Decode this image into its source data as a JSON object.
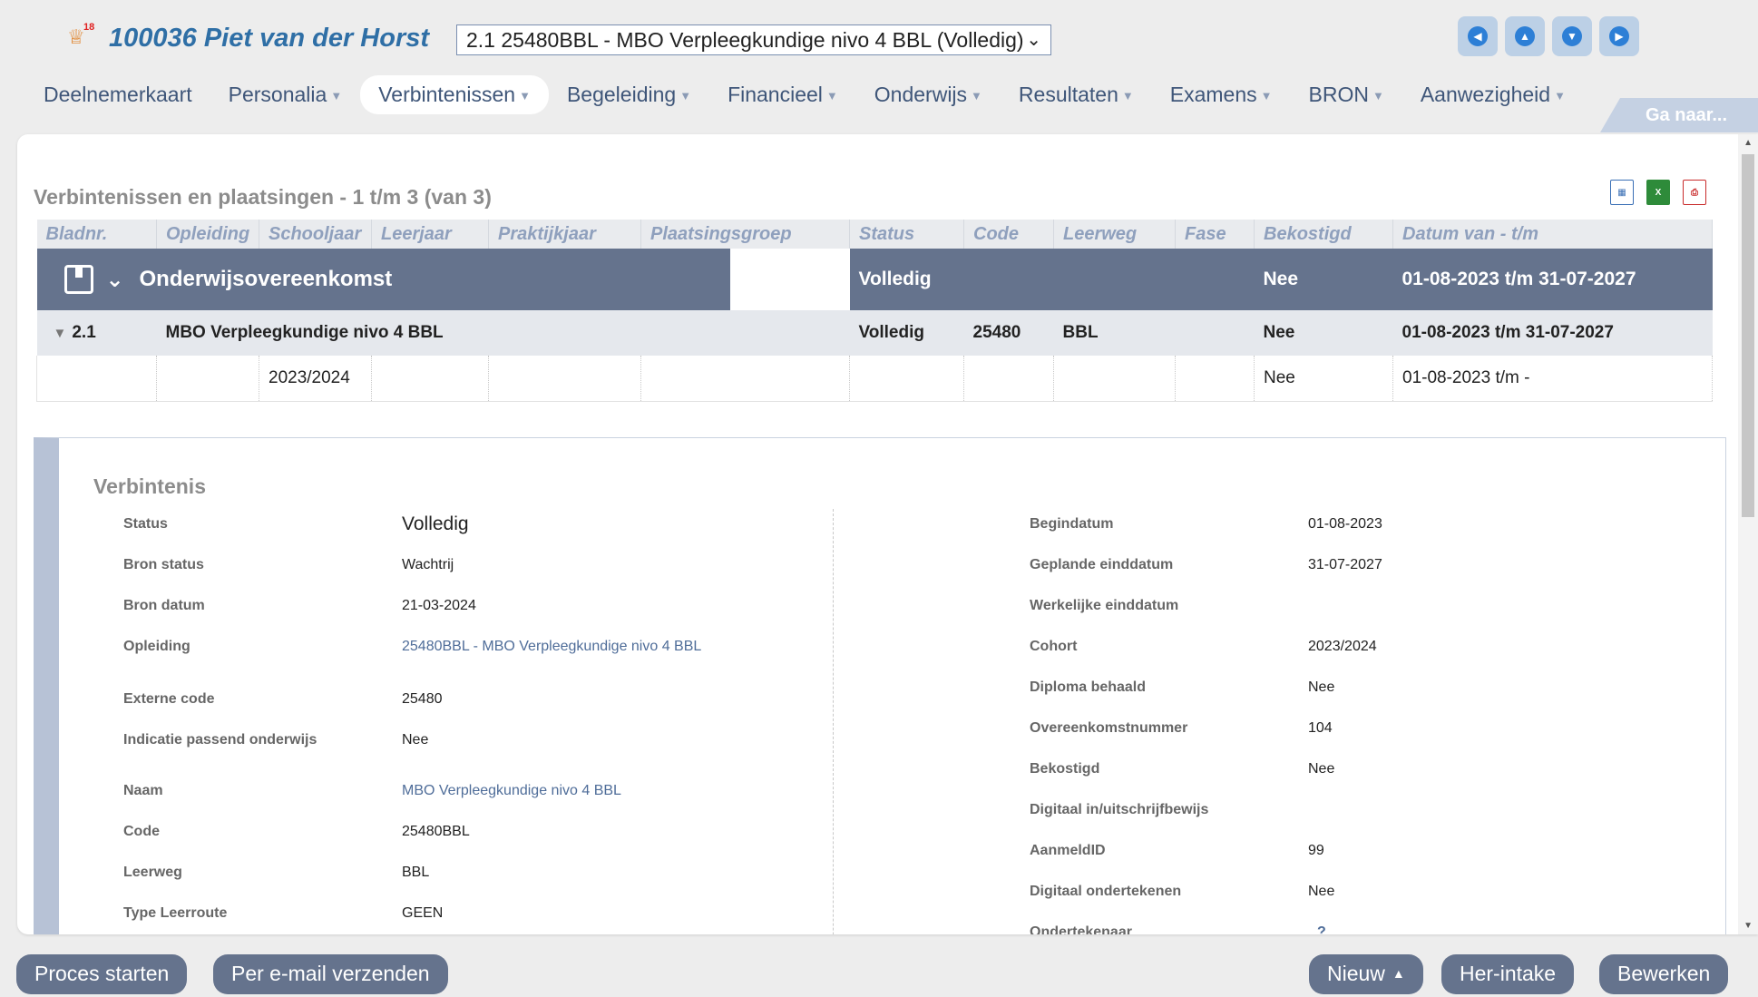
{
  "header": {
    "student_badge": "18",
    "student_title": "100036 Piet van der Horst",
    "program_select": "2.1 25480BBL - MBO Verpleegkundige nivo 4 BBL (Volledig)",
    "nav_icons": [
      "previous-icon",
      "up-icon",
      "down-icon",
      "next-icon"
    ]
  },
  "menu": [
    {
      "label": "Deelnemerkaart",
      "dropdown": false
    },
    {
      "label": "Personalia",
      "dropdown": true
    },
    {
      "label": "Verbintenissen",
      "dropdown": true,
      "active": true
    },
    {
      "label": "Begeleiding",
      "dropdown": true
    },
    {
      "label": "Financieel",
      "dropdown": true
    },
    {
      "label": "Onderwijs",
      "dropdown": true
    },
    {
      "label": "Resultaten",
      "dropdown": true
    },
    {
      "label": "Examens",
      "dropdown": true
    },
    {
      "label": "BRON",
      "dropdown": true
    },
    {
      "label": "Aanwezigheid",
      "dropdown": true
    }
  ],
  "goto_label": "Ga naar...",
  "list": {
    "title": "Verbintenissen en plaatsingen - 1 t/m 3 (van 3)",
    "columns": [
      "Bladnr.",
      "Opleiding",
      "Schooljaar",
      "Leerjaar",
      "Praktijkjaar",
      "Plaatsingsgroep",
      "Status",
      "Code",
      "Leerweg",
      "Fase",
      "Bekostigd",
      "Datum van - t/m"
    ],
    "group": {
      "name": "Onderwijsovereenkomst",
      "status": "Volledig",
      "bekostigd": "Nee",
      "datum": "01-08-2023 t/m 31-07-2027"
    },
    "row1": {
      "bladnr": "2.1",
      "opleiding": "MBO Verpleegkundige nivo 4 BBL",
      "status": "Volledig",
      "code": "25480",
      "leerweg": "BBL",
      "bekostigd": "Nee",
      "datum": "01-08-2023 t/m 31-07-2027"
    },
    "row2": {
      "schooljaar": "2023/2024",
      "bekostigd": "Nee",
      "datum": "01-08-2023 t/m -"
    }
  },
  "detail": {
    "title": "Verbintenis",
    "left": [
      {
        "label": "Status",
        "value": "Volledig"
      },
      {
        "label": "Bron status",
        "value": "Wachtrij"
      },
      {
        "label": "Bron datum",
        "value": "21-03-2024"
      },
      {
        "label": "Opleiding",
        "value": "25480BBL - MBO Verpleegkundige nivo 4 BBL",
        "link": true
      },
      {
        "label": "Externe code",
        "value": "25480"
      },
      {
        "label": "Indicatie passend onderwijs",
        "value": "Nee"
      },
      {
        "label": "Naam",
        "value": "MBO Verpleegkundige nivo 4 BBL",
        "link": true
      },
      {
        "label": "Code",
        "value": "25480BBL"
      },
      {
        "label": "Leerweg",
        "value": "BBL"
      },
      {
        "label": "Type Leerroute",
        "value": "GEEN"
      }
    ],
    "right": [
      {
        "label": "Begindatum",
        "value": "01-08-2023"
      },
      {
        "label": "Geplande einddatum",
        "value": "31-07-2027"
      },
      {
        "label": "Werkelijke einddatum",
        "value": ""
      },
      {
        "label": "Cohort",
        "value": "2023/2024"
      },
      {
        "label": "Diploma behaald",
        "value": "Nee"
      },
      {
        "label": "Overeenkomstnummer",
        "value": "104"
      },
      {
        "label": "Bekostigd",
        "value": "Nee"
      },
      {
        "label": "Digitaal in/uitschrijfbewijs",
        "value": ""
      },
      {
        "label": "AanmeldID",
        "value": "99"
      },
      {
        "label": "Digitaal ondertekenen",
        "value": "Nee"
      },
      {
        "label": "Ondertekenaar",
        "value": "?"
      }
    ]
  },
  "actions": {
    "proces_starten": "Proces starten",
    "email": "Per e-mail verzenden",
    "nieuw": "Nieuw",
    "her_intake": "Her-intake",
    "bewerken": "Bewerken"
  }
}
